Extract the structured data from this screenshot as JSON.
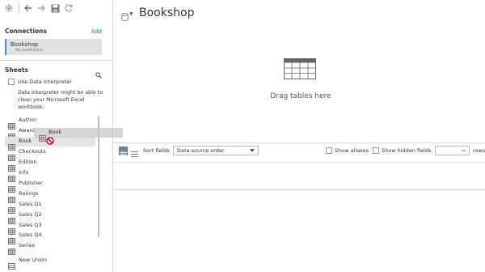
{
  "toolbar": {
    "icons": [
      "tableau-logo-icon",
      "back-arrow-icon",
      "forward-arrow-icon",
      "save-icon",
      "refresh-icon"
    ]
  },
  "connections": {
    "heading": "Connections",
    "add_label": "Add",
    "items": [
      {
        "name": "Bookshop",
        "type": "Microsoft Excel"
      }
    ]
  },
  "sheets": {
    "heading": "Sheets",
    "use_interpreter_label": "Use Data Interpreter",
    "interpreter_note": "Data Interpreter might be able to clean your Microsoft Excel workbook.",
    "items": [
      {
        "label": "Author"
      },
      {
        "label": "Award"
      },
      {
        "label": "Book"
      },
      {
        "label": "Checkouts"
      },
      {
        "label": "Edition"
      },
      {
        "label": "Info"
      },
      {
        "label": "Publisher"
      },
      {
        "label": "Ratings"
      },
      {
        "label": "Sales Q1"
      },
      {
        "label": "Sales Q2"
      },
      {
        "label": "Sales Q3"
      },
      {
        "label": "Sales Q4"
      },
      {
        "label": "Series"
      }
    ],
    "selected": "Book",
    "new_union_label": "New Union"
  },
  "drag": {
    "label": "Book"
  },
  "canvas": {
    "title": "Bookshop",
    "drop_hint": "Drag tables here"
  },
  "grid_toolbar": {
    "sort_label": "Sort fields",
    "sort_value": "Data source order",
    "show_aliases_label": "Show aliases",
    "show_hidden_label": "Show hidden fields",
    "rows_label": "rows"
  },
  "colors": {
    "accent": "#1f77b4",
    "connection_bar": "#4a90c8",
    "no_drop": "#d0021b"
  }
}
